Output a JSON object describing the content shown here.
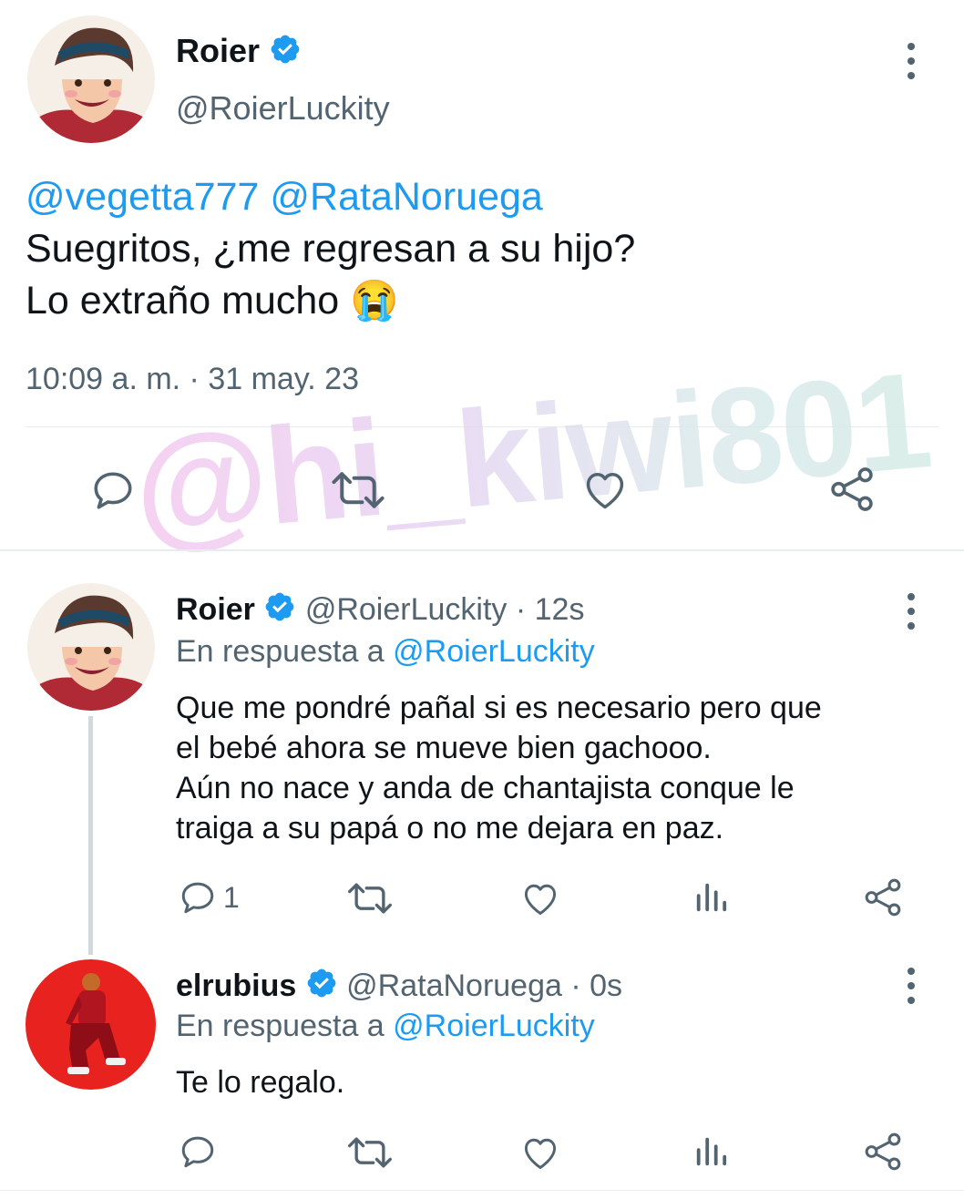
{
  "main_tweet": {
    "display_name": "Roier",
    "handle": "@RoierLuckity",
    "mentions": "@vegetta777 @RataNoruega",
    "line1": "Suegritos, ¿me regresan a su hijo?",
    "line2": "Lo extraño mucho",
    "emoji": "😭",
    "timestamp": "10:09 a. m. · 31 may. 23"
  },
  "watermark": "@hi_kiwi801",
  "replies": [
    {
      "display_name": "Roier",
      "handle": "@RoierLuckity",
      "time": "· 12s",
      "replying_prefix": "En respuesta a",
      "replying_to": "@RoierLuckity",
      "text_lines": [
        "Que me pondré pañal si es necesario pero que",
        "el bebé ahora se mueve bien gachooo.",
        "Aún no nace y anda de chantajista conque le",
        "traiga a su papá o no me dejara en paz."
      ],
      "reply_count": "1"
    },
    {
      "display_name": "elrubius",
      "handle": "@RataNoruega",
      "time": "· 0s",
      "replying_prefix": "En respuesta a",
      "replying_to": "@RoierLuckity",
      "text_lines": [
        "Te lo regalo."
      ]
    }
  ],
  "icons": {
    "verified": "verified-badge-icon",
    "more": "more-options-icon",
    "reply": "reply-icon",
    "retweet": "retweet-icon",
    "like": "heart-icon",
    "views": "analytics-icon",
    "share": "share-icon"
  },
  "colors": {
    "accent": "#1d9bf0",
    "text": "#0f1419",
    "muted": "#536471",
    "divider": "#e6ecf0"
  }
}
